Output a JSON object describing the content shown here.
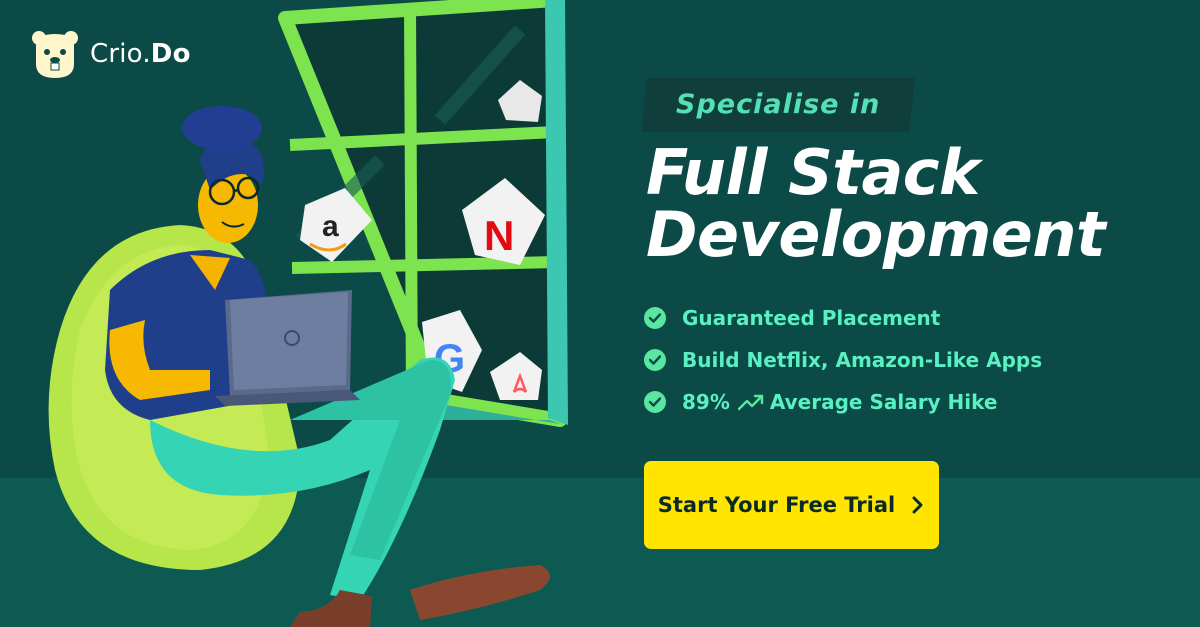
{
  "brand": {
    "name_main": "Crio.",
    "name_bold": "Do",
    "logo_icon": "beaver-face-icon"
  },
  "tagline": "Specialise in",
  "headline": {
    "line1": "Full Stack",
    "line2": "Development"
  },
  "features": [
    {
      "text": "Guaranteed Placement",
      "icon": "check-circle-icon"
    },
    {
      "text": "Build Netflix, Amazon-Like Apps",
      "icon": "check-circle-icon"
    },
    {
      "prefix": "89%",
      "text": "Average Salary Hike",
      "icon": "check-circle-icon",
      "extra_icon": "trending-up-icon"
    }
  ],
  "cta": {
    "label": "Start Your Free Trial",
    "icon": "chevron-right-icon"
  },
  "illustration": {
    "window_logos": [
      "a",
      "N",
      "G",
      "airbnb-icon"
    ]
  },
  "colors": {
    "background": "#0b4a46",
    "accent_green": "#53e0b4",
    "cta_yellow": "#ffe500",
    "headline": "#ffffff"
  }
}
